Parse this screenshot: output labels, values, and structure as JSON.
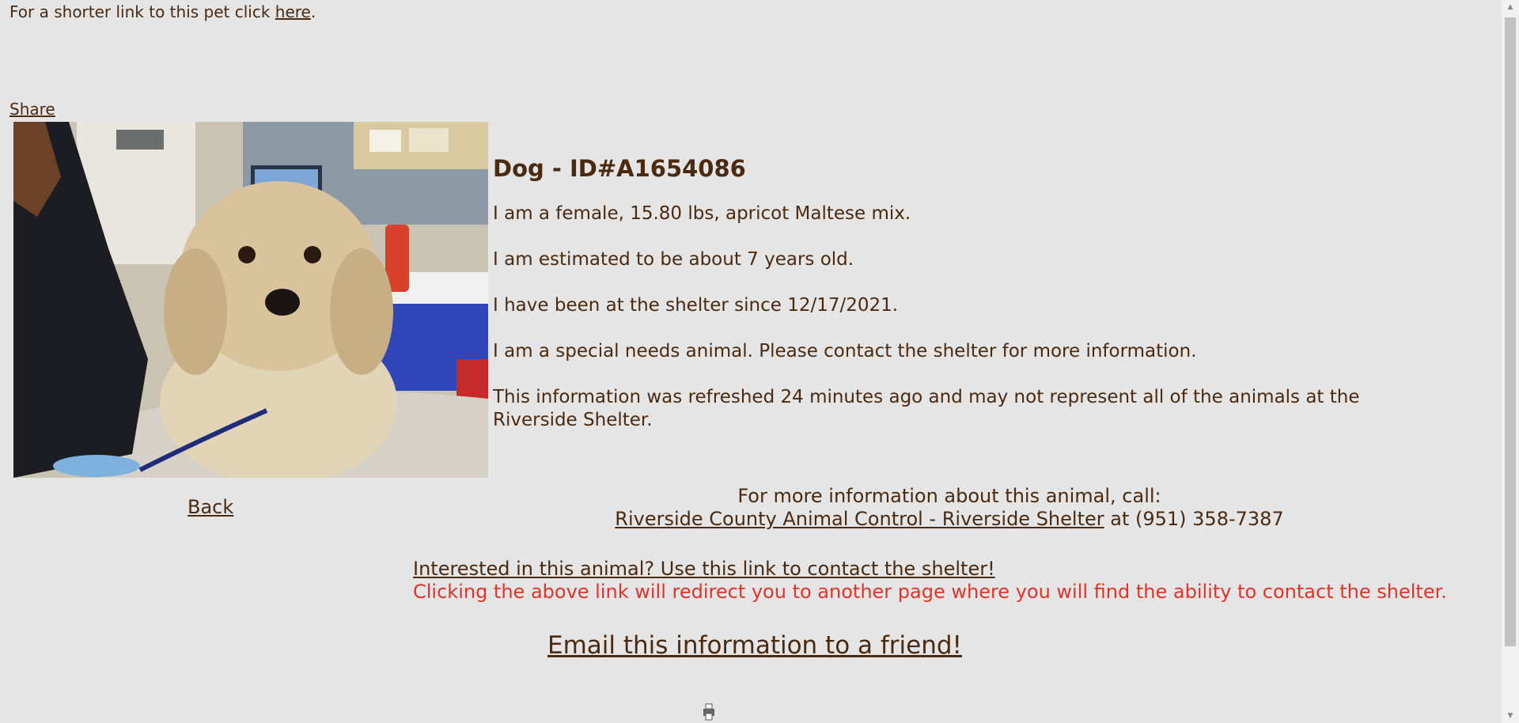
{
  "top": {
    "shorter_prefix": "For a shorter link to this pet click ",
    "shorter_link": "here",
    "shorter_suffix": "."
  },
  "share_label": "Share",
  "animal": {
    "title": "Dog - ID#A1654086",
    "line1": "I am a female, 15.80 lbs, apricot Maltese mix.",
    "line2": "I am estimated to be about 7 years old.",
    "line3": "I have been at the shelter since 12/17/2021.",
    "line4": "I am a special needs animal. Please contact the shelter for more information.",
    "line5": "This information was refreshed 24 minutes ago and may not represent all of the animals at the Riverside Shelter."
  },
  "back_label": "Back",
  "contact": {
    "intro": "For more information about this animal, call:",
    "shelter_link": "Riverside County Animal Control - Riverside Shelter",
    "phone_text": " at (951) 358-7387"
  },
  "interested": {
    "link": "Interested in this animal? Use this link to contact the shelter!",
    "note": "Clicking the above link will redirect you to another page where you will find the ability to contact the shelter."
  },
  "email_label": "Email this information to a friend!",
  "colors": {
    "background": "#e5e5e5",
    "text": "#4a2a10",
    "warning": "#e0342a"
  }
}
